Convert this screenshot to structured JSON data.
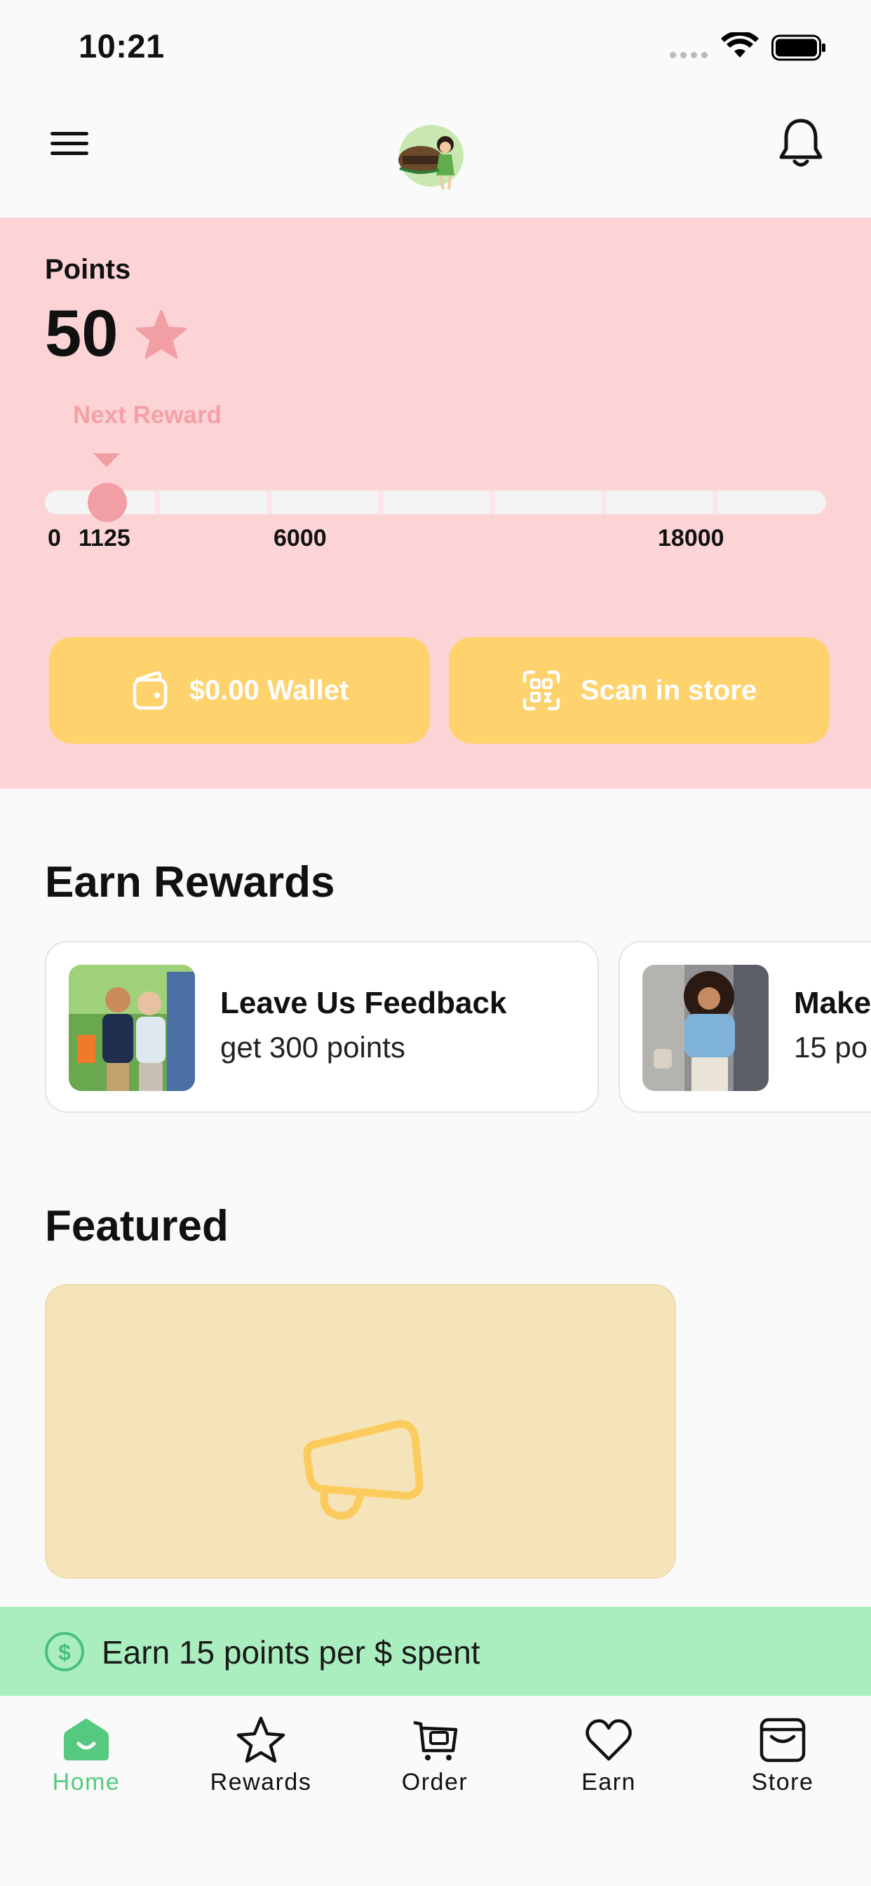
{
  "status_bar": {
    "time": "10:21"
  },
  "header": {
    "menu_icon": "hamburger-menu-icon",
    "logo": "restaurant-logo",
    "notification_icon": "bell-icon"
  },
  "points": {
    "label": "Points",
    "value": "50",
    "star_icon": "star-icon",
    "next_reward_label": "Next Reward",
    "progress_current": 50,
    "progress_max": 18000,
    "ticks": [
      "0",
      "1125",
      "6000",
      "18000"
    ]
  },
  "actions": {
    "wallet": {
      "label": "$0.00 Wallet",
      "icon": "wallet-icon"
    },
    "scan": {
      "label": "Scan in store",
      "icon": "qr-scan-icon"
    }
  },
  "earn_rewards": {
    "title": "Earn Rewards",
    "cards": [
      {
        "title": "Leave Us Feedback",
        "subtitle": "get 300 points"
      },
      {
        "title": "Make",
        "subtitle": "15 po"
      }
    ]
  },
  "featured": {
    "title": "Featured",
    "icon": "megaphone-icon"
  },
  "earn_banner": {
    "text": "Earn 15 points per $ spent",
    "icon": "dollar-circle-icon"
  },
  "tabs": [
    {
      "label": "Home",
      "icon": "home-icon",
      "active": true
    },
    {
      "label": "Rewards",
      "icon": "star-outline-icon",
      "active": false
    },
    {
      "label": "Order",
      "icon": "cart-icon",
      "active": false
    },
    {
      "label": "Earn",
      "icon": "heart-icon",
      "active": false
    },
    {
      "label": "Store",
      "icon": "store-icon",
      "active": false
    }
  ],
  "colors": {
    "points_panel_bg": "#fdd4d6",
    "accent_pink": "#f19ea4",
    "action_button": "#fed26c",
    "earn_banner_bg": "#aaeebf",
    "active_tab": "#55c97f",
    "featured_bg": "#f5e4b9"
  }
}
